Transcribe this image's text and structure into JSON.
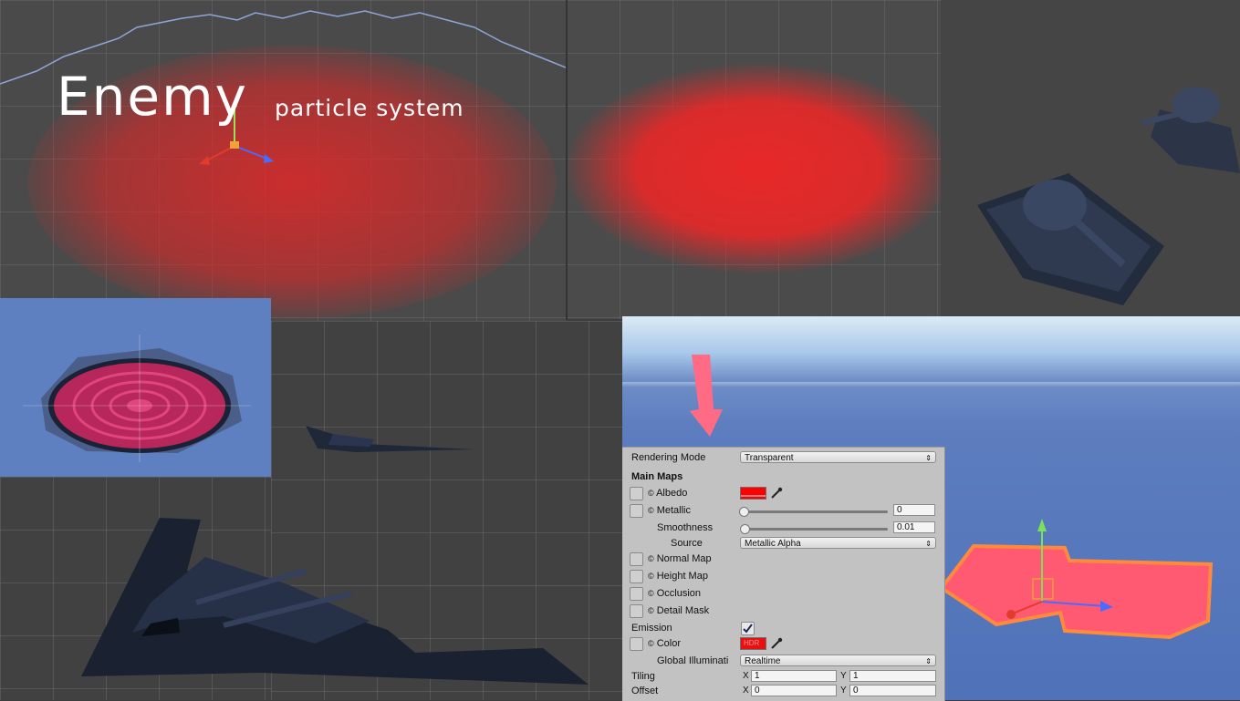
{
  "title": {
    "main": "Enemy",
    "sub": "particle system"
  },
  "inspector": {
    "rendering_mode_label": "Rendering Mode",
    "rendering_mode_value": "Transparent",
    "main_maps_label": "Main Maps",
    "albedo_label": "Albedo",
    "albedo_color": "#ff0000",
    "metallic_label": "Metallic",
    "metallic_value": "0",
    "smoothness_label": "Smoothness",
    "smoothness_value": "0.01",
    "source_label": "Source",
    "source_value": "Metallic Alpha",
    "normal_map_label": "Normal Map",
    "height_map_label": "Height Map",
    "occlusion_label": "Occlusion",
    "detail_mask_label": "Detail Mask",
    "emission_label": "Emission",
    "emission_checked": true,
    "color_label": "Color",
    "color_hdr_text": "HDR",
    "gi_label": "Global Illuminati",
    "gi_value": "Realtime",
    "tiling_label": "Tiling",
    "tiling_x": "1",
    "tiling_y": "1",
    "offset_label": "Offset",
    "offset_x": "0",
    "offset_y": "0",
    "x_label": "X",
    "y_label": "Y",
    "texture_icon_glyph": "©",
    "dropdown_arrow": "⇕"
  },
  "colors": {
    "particle_red": "#e82b2b",
    "sky_blue": "#5b7fbf",
    "highlight_pink": "#ff5a72"
  }
}
